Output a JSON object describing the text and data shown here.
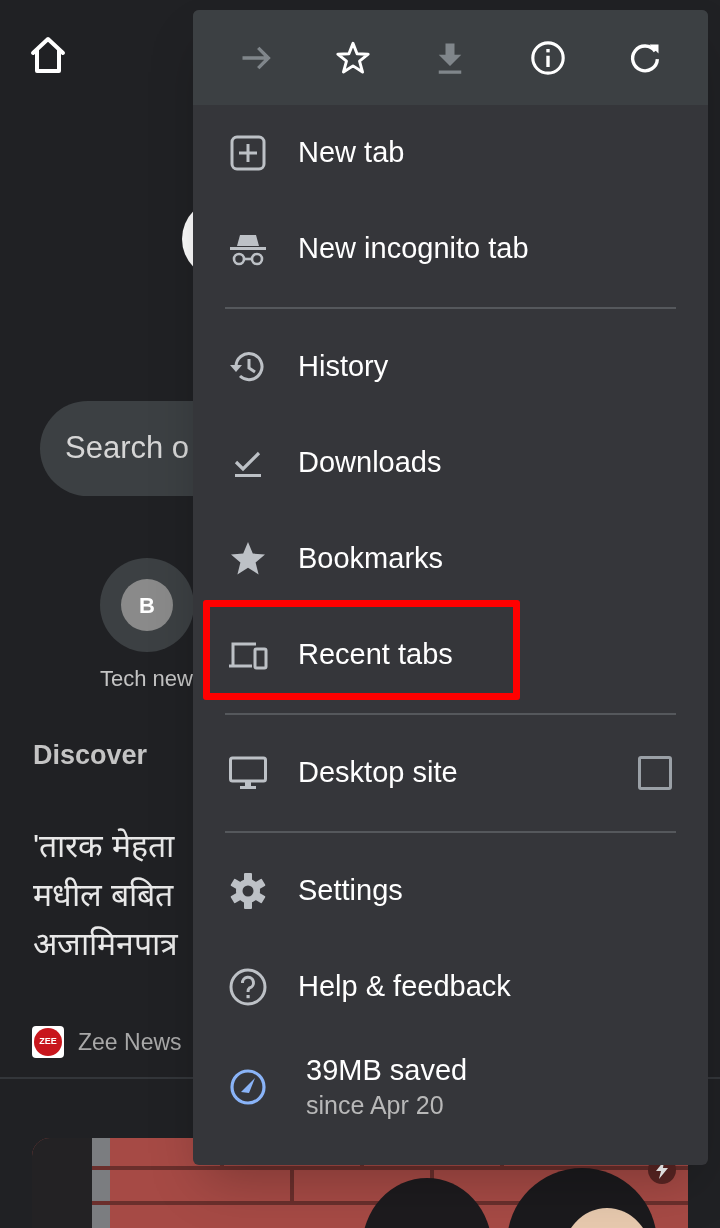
{
  "page": {
    "search": {
      "placeholder": "Search o"
    },
    "shortcut": {
      "letter": "B",
      "label": "Tech new"
    },
    "discover": {
      "title": "Discover"
    },
    "article": {
      "headline_lines": [
        "'तारक मेहता",
        "मधील बबित",
        "अजामिनपात्र"
      ],
      "source": "Zee News",
      "logo_text": "ZEE"
    }
  },
  "menu": {
    "toolbar": [
      {
        "kind": "forward",
        "disabled": true
      },
      {
        "kind": "star",
        "disabled": false
      },
      {
        "kind": "download",
        "disabled": true
      },
      {
        "kind": "info",
        "disabled": false
      },
      {
        "kind": "reload",
        "disabled": false
      }
    ],
    "sections": [
      [
        {
          "kind": "new-tab",
          "label": "New tab",
          "highlighted": false
        },
        {
          "kind": "incognito",
          "label": "New incognito tab",
          "highlighted": false
        }
      ],
      [
        {
          "kind": "history",
          "label": "History",
          "highlighted": false
        },
        {
          "kind": "downloads",
          "label": "Downloads",
          "highlighted": false
        },
        {
          "kind": "bookmarks",
          "label": "Bookmarks",
          "highlighted": false
        },
        {
          "kind": "recent-tabs",
          "label": "Recent tabs",
          "highlighted": true
        }
      ],
      [
        {
          "kind": "desktop",
          "label": "Desktop site",
          "highlighted": false,
          "checked": false
        }
      ],
      [
        {
          "kind": "settings",
          "label": "Settings",
          "highlighted": false
        },
        {
          "kind": "help",
          "label": "Help & feedback",
          "highlighted": false
        },
        {
          "kind": "savings",
          "label": "39MB saved",
          "sublabel": "since Apr 20",
          "highlighted": false
        }
      ]
    ]
  }
}
